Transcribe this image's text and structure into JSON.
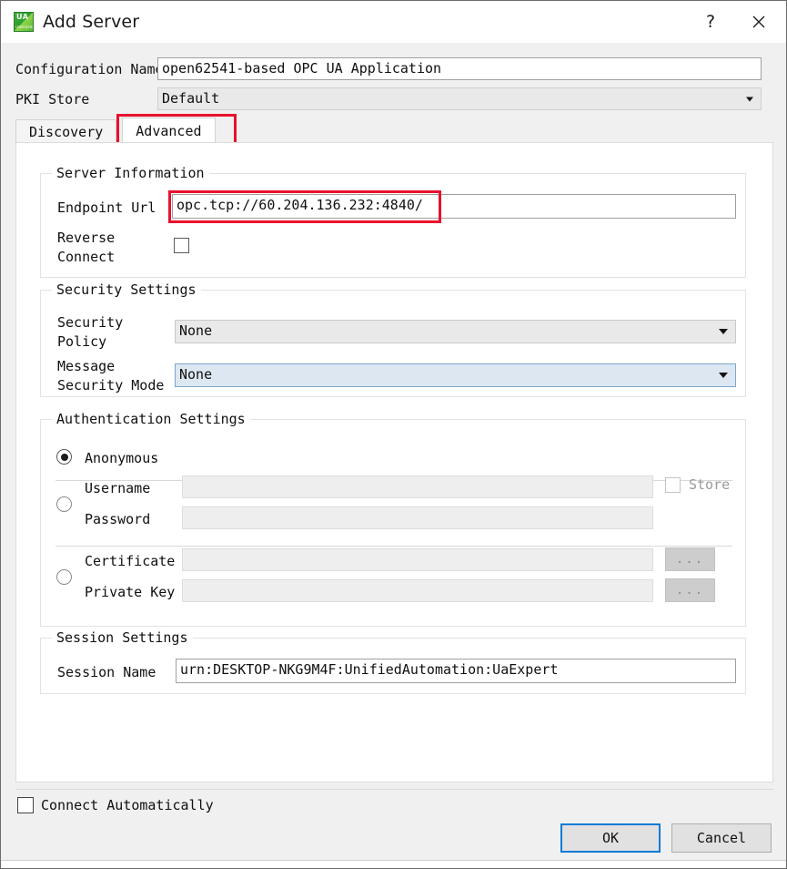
{
  "window": {
    "title": "Add Server",
    "icon": "uaexpert-icon",
    "icon_text_top": "UA",
    "icon_text_bottom": "uaexpert",
    "help_label": "?",
    "close_label": "✕"
  },
  "top_form": {
    "configuration_name_label": "Configuration Name",
    "configuration_name_value": "open62541-based OPC UA Application",
    "pki_store_label": "PKI Store",
    "pki_store_value": "Default"
  },
  "tabs": [
    {
      "label": "Discovery",
      "active": false
    },
    {
      "label": "Advanced",
      "active": true
    }
  ],
  "highlights": {
    "accent_color": "#e8112d"
  },
  "server_information": {
    "group_title": "Server Information",
    "endpoint_url_label": "Endpoint Url",
    "endpoint_url_value": "opc.tcp://60.204.136.232:4840/",
    "reverse_connect_label_line1": "Reverse",
    "reverse_connect_label_line2": "Connect",
    "reverse_connect_checked": false
  },
  "security_settings": {
    "group_title": "Security Settings",
    "security_policy_label_line1": "Security",
    "security_policy_label_line2": "Policy",
    "security_policy_value": "None",
    "message_security_mode_label_line1": "Message",
    "message_security_mode_label_line2": "Security Mode",
    "message_security_mode_value": "None"
  },
  "authentication_settings": {
    "group_title": "Authentication Settings",
    "anonymous_label": "Anonymous",
    "anonymous_selected": true,
    "username_label": "Username",
    "username_value": "",
    "password_label": "Password",
    "password_value": "",
    "store_label": "Store",
    "store_checked": false,
    "certificate_label": "Certificate",
    "certificate_value": "",
    "private_key_label": "Private Key",
    "private_key_value": "",
    "browse_button_label": "...",
    "username_selected": false,
    "certificate_selected": false
  },
  "session_settings": {
    "group_title": "Session Settings",
    "session_name_label": "Session Name",
    "session_name_value": "urn:DESKTOP-NKG9M4F:UnifiedAutomation:UaExpert"
  },
  "footer": {
    "connect_automatically_label": "Connect Automatically",
    "connect_automatically_checked": false,
    "ok_label": "OK",
    "cancel_label": "Cancel"
  }
}
